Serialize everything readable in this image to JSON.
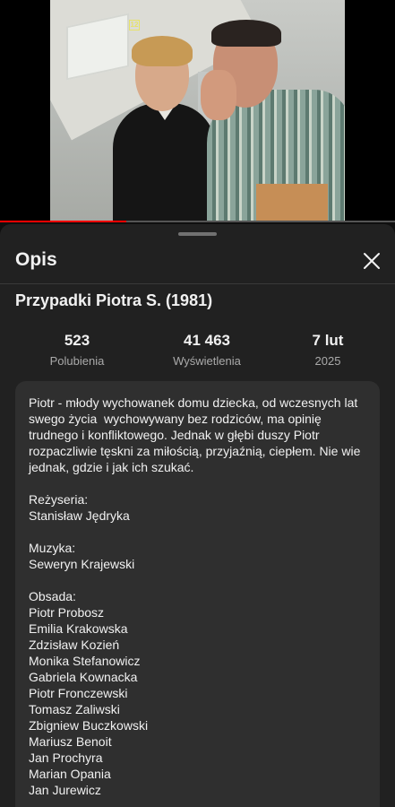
{
  "video": {
    "rating_badge": "12",
    "progress": 0.32
  },
  "sheet": {
    "title": "Opis",
    "close_icon": "close-icon",
    "video_title": "Przypadki Piotra S. (1981)"
  },
  "stats": [
    {
      "value": "523",
      "label": "Polubienia"
    },
    {
      "value": "41 463",
      "label": "Wyświetlenia"
    },
    {
      "value": "7 lut",
      "label": "2025"
    }
  ],
  "description": {
    "summary": "Piotr - młody wychowanek domu dziecka, od wczesnych lat swego życia  wychowywany bez rodziców, ma opinię trudnego i konfliktowego. Jednak w głębi duszy Piotr rozpaczliwie tęskni za miłością, przyjaźnią, ciepłem. Nie wie jednak, gdzie i jak ich szukać.",
    "director_label": "Reżyseria:",
    "director": "Stanisław Jędryka",
    "music_label": "Muzyka:",
    "music": "Seweryn Krajewski",
    "cast_label": "Obsada:",
    "cast": [
      "Piotr Probosz",
      "Emilia Krakowska",
      "Zdzisław Kozień",
      "Monika Stefanowicz",
      "Gabriela Kownacka",
      "Piotr Fronczewski",
      "Tomasz Zaliwski",
      "Zbigniew Buczkowski",
      "Mariusz Benoit",
      "Jan Prochyra",
      "Marian Opania",
      "Jan Jurewicz"
    ]
  }
}
